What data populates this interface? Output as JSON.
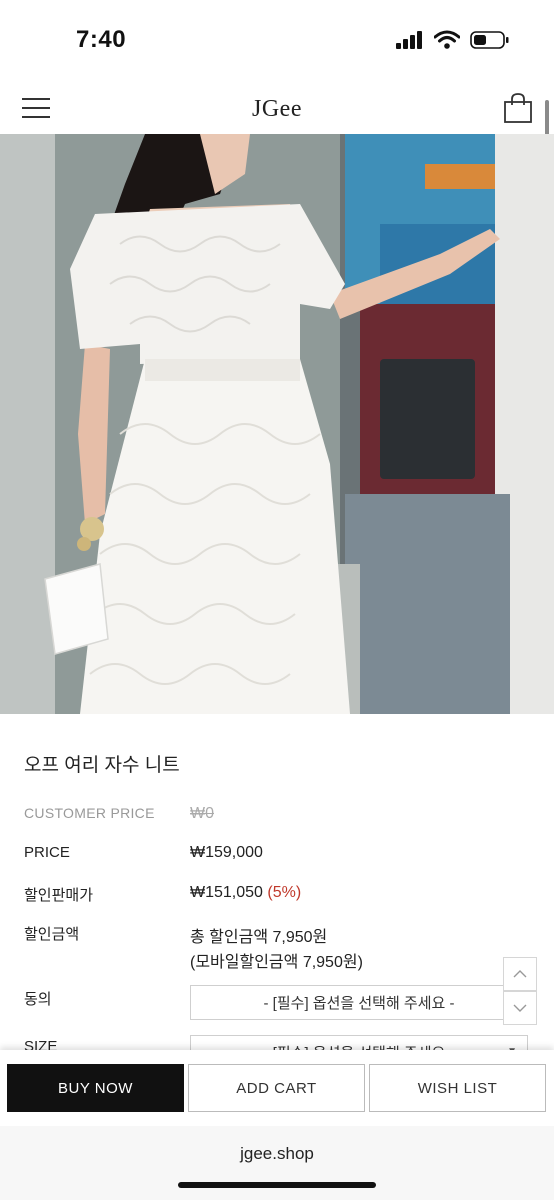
{
  "status_bar": {
    "time": "7:40"
  },
  "header": {
    "logo": "JGee"
  },
  "product": {
    "title": "오프 여리 자수 니트",
    "customer_price_label": "CUSTOMER PRICE",
    "customer_price": "₩0",
    "price_label": "PRICE",
    "price": "₩159,000",
    "sale_label": "할인판매가",
    "sale_price": "₩151,050",
    "sale_percent": "(5%)",
    "discount_label": "할인금액",
    "discount_total": "총 할인금액 7,950원",
    "discount_mobile": "(모바일할인금액 7,950원)",
    "agree_label": "동의",
    "agree_select": "- [필수] 옵션을 선택해 주세요 -",
    "size_label": "SIZE",
    "size_select": "- [필수] 옵션을 선택해 주세요 -"
  },
  "actions": {
    "buy_now": "BUY NOW",
    "add_cart": "ADD CART",
    "wish_list": "WISH LIST"
  },
  "browser": {
    "url": "jgee.shop"
  },
  "colors": {
    "accent_red": "#c0392b",
    "primary_button": "#111111"
  }
}
